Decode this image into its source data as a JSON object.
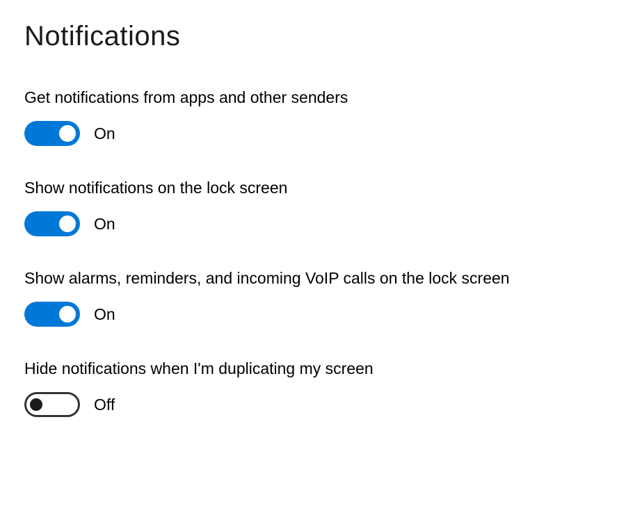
{
  "header": {
    "title": "Notifications"
  },
  "settings": [
    {
      "label": "Get notifications from apps and other senders",
      "state": "On",
      "enabled": true
    },
    {
      "label": "Show notifications on the lock screen",
      "state": "On",
      "enabled": true
    },
    {
      "label": "Show alarms, reminders, and incoming VoIP calls on the lock screen",
      "state": "On",
      "enabled": true
    },
    {
      "label": "Hide notifications when I'm duplicating my screen",
      "state": "Off",
      "enabled": false
    }
  ],
  "colors": {
    "toggle_on": "#0078d7",
    "toggle_off_border": "#333333",
    "text": "#000000"
  }
}
